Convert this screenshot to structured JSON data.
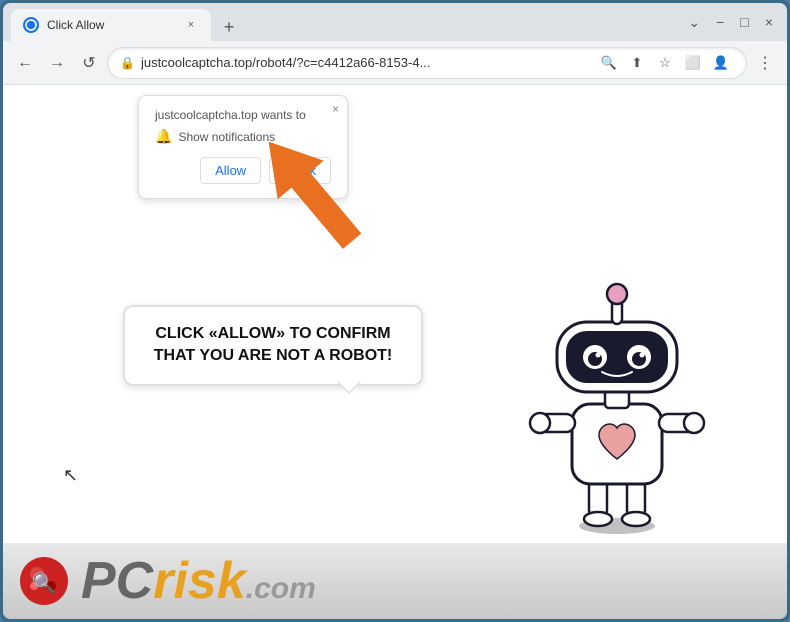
{
  "browser": {
    "tab": {
      "favicon_label": "tab-favicon",
      "title": "Click Allow",
      "close_label": "×",
      "new_tab_label": "+"
    },
    "window_controls": {
      "chevron": "⌄",
      "minimize": "−",
      "restore": "□",
      "close": "×"
    },
    "nav": {
      "back": "←",
      "forward": "→",
      "refresh": "↺"
    },
    "address": {
      "url": "justcoolcaptcha.top/robot4/?c=c4412a66-8153-4...",
      "lock_icon": "🔒"
    },
    "address_icons": {
      "search": "🔍",
      "share": "⬆",
      "star": "☆",
      "splitscreen": "⬜",
      "profile": "👤",
      "menu": "⋮"
    }
  },
  "notification_popup": {
    "site_text": "justcoolcaptcha.top wants to",
    "close_label": "×",
    "bell_label": "🔔",
    "notification_text": "Show notifications",
    "allow_label": "Allow",
    "block_label": "Block"
  },
  "speech_bubble": {
    "text": "CLICK «ALLOW» TO CONFIRM THAT YOU ARE NOT A ROBOT!"
  },
  "pcrisk": {
    "pc_text": "PC",
    "risk_text": "risk",
    "dot_com": ".com"
  }
}
